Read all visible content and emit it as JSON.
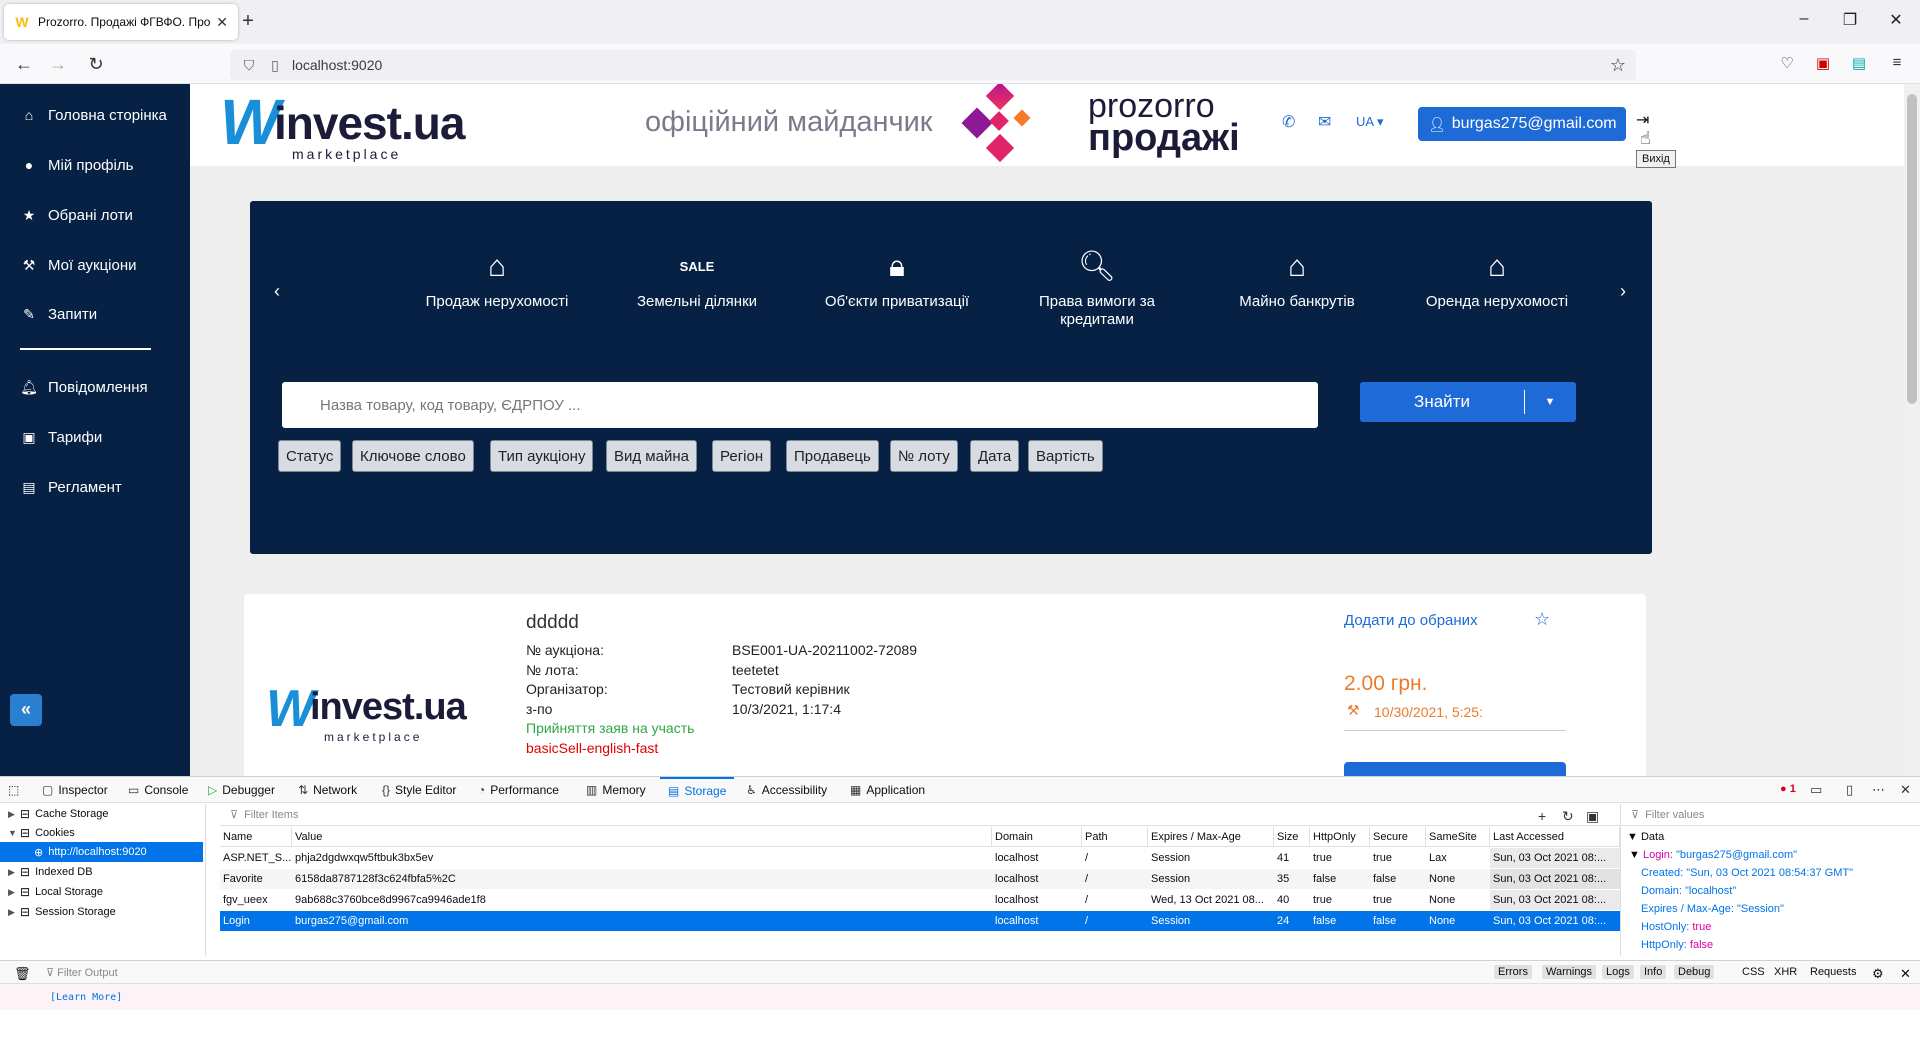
{
  "browser": {
    "tab_title": "Prozorro. Продажі ФГВФО. Про",
    "url": "localhost:9020"
  },
  "sidebar": {
    "items": [
      {
        "label": "Головна сторінка",
        "icon": "home-icon"
      },
      {
        "label": "Мій профіль",
        "icon": "user-icon"
      },
      {
        "label": "Обрані лоти",
        "icon": "star-icon"
      },
      {
        "label": "Мої аукціони",
        "icon": "gavel-icon"
      },
      {
        "label": "Запити",
        "icon": "pencil-icon"
      },
      {
        "label": "Повідомлення",
        "icon": "bell-icon"
      },
      {
        "label": "Тарифи",
        "icon": "money-icon"
      },
      {
        "label": "Регламент",
        "icon": "document-icon"
      }
    ]
  },
  "header": {
    "logo_main": "invest.ua",
    "logo_sub": "marketplace",
    "official": "офіційний майданчик",
    "prozorro_line1": "prozorro",
    "prozorro_line2": "продажі",
    "lang": "UA",
    "user_email": "burgas275@gmail.com",
    "logout_tooltip": "Вихід"
  },
  "banner": {
    "categories": [
      {
        "label": "Продаж нерухомості",
        "icon": "house-check-icon"
      },
      {
        "label": "Земельні ділянки",
        "icon": "sale-sign-icon"
      },
      {
        "label": "Об'єкти приватизації",
        "icon": "lock-icon"
      },
      {
        "label": "Права вимоги за кредитами",
        "icon": "document-search-icon"
      },
      {
        "label": "Майно банкрутів",
        "icon": "hands-house-icon"
      },
      {
        "label": "Оренда нерухомості",
        "icon": "house-dollar-icon"
      }
    ],
    "search_placeholder": "Назва товару, код товару, ЄДРПОУ ...",
    "find_label": "Знайти",
    "filters": [
      "Статус",
      "Ключове слово",
      "Тип аукціону",
      "Вид майна",
      "Регіон",
      "Продавець",
      "№ лоту",
      "Дата",
      "Вартість"
    ]
  },
  "lot": {
    "title": "ddddd",
    "rows": [
      {
        "label": "№ аукціона:",
        "value": "BSE001-UA-20211002-72089"
      },
      {
        "label": "№ лота:",
        "value": "teetetet"
      },
      {
        "label": "Організатор:",
        "value": "Тестовий керівник"
      },
      {
        "label": "з-по",
        "value": "10/3/2021, 1:17:4"
      }
    ],
    "status": "Прийняття заяв на участь",
    "type": "basicSell-english-fast",
    "fav_link": "Додати до обраних",
    "price": "2.00 грн.",
    "date": "10/30/2021, 5:25:"
  },
  "devtools": {
    "tabs": [
      "Inspector",
      "Console",
      "Debugger",
      "Network",
      "Style Editor",
      "Performance",
      "Memory",
      "Storage",
      "Accessibility",
      "Application"
    ],
    "active_tab": "Storage",
    "error_count": "1",
    "tree": {
      "cache": "Cache Storage",
      "cookies": "Cookies",
      "host": "http://localhost:9020",
      "indexed": "Indexed DB",
      "local": "Local Storage",
      "session": "Session Storage"
    },
    "filter_items": "Filter Items",
    "columns": [
      "Name",
      "Value",
      "Domain",
      "Path",
      "Expires / Max-Age",
      "Size",
      "HttpOnly",
      "Secure",
      "SameSite",
      "Last Accessed"
    ],
    "rows": [
      [
        "ASP.NET_S...",
        "phja2dgdwxqw5ftbuk3bx5ev",
        "localhost",
        "/",
        "Session",
        "41",
        "true",
        "true",
        "Lax",
        "Sun, 03 Oct 2021 08:..."
      ],
      [
        "Favorite",
        "6158da8787128f3c624fbfa5%2C",
        "localhost",
        "/",
        "Session",
        "35",
        "false",
        "false",
        "None",
        "Sun, 03 Oct 2021 08:..."
      ],
      [
        "fgv_ueex",
        "9ab688c3760bce8d9967ca9946ade1f8",
        "localhost",
        "/",
        "Wed, 13 Oct 2021 08...",
        "40",
        "true",
        "true",
        "None",
        "Sun, 03 Oct 2021 08:..."
      ],
      [
        "Login",
        "burgas275@gmail.com",
        "localhost",
        "/",
        "Session",
        "24",
        "false",
        "false",
        "None",
        "Sun, 03 Oct 2021 08:..."
      ]
    ],
    "filter_values": "Filter values",
    "data_header": "Data",
    "data_lines": [
      {
        "key": "Login:",
        "val": "\"burgas275@gmail.com\""
      },
      {
        "key": "Created:",
        "val": "\"Sun, 03 Oct 2021 08:54:37 GMT\""
      },
      {
        "key": "Domain:",
        "val": "\"localhost\""
      },
      {
        "key": "Expires / Max-Age:",
        "val": "\"Session\""
      },
      {
        "key": "HostOnly:",
        "val": "true"
      },
      {
        "key": "HttpOnly:",
        "val": "false"
      }
    ],
    "filter_output": "Filter Output",
    "console_filters": [
      "Errors",
      "Warnings",
      "Logs",
      "Info",
      "Debug"
    ],
    "console_extra": [
      "CSS",
      "XHR",
      "Requests"
    ],
    "learn_more": "[Learn More]"
  }
}
